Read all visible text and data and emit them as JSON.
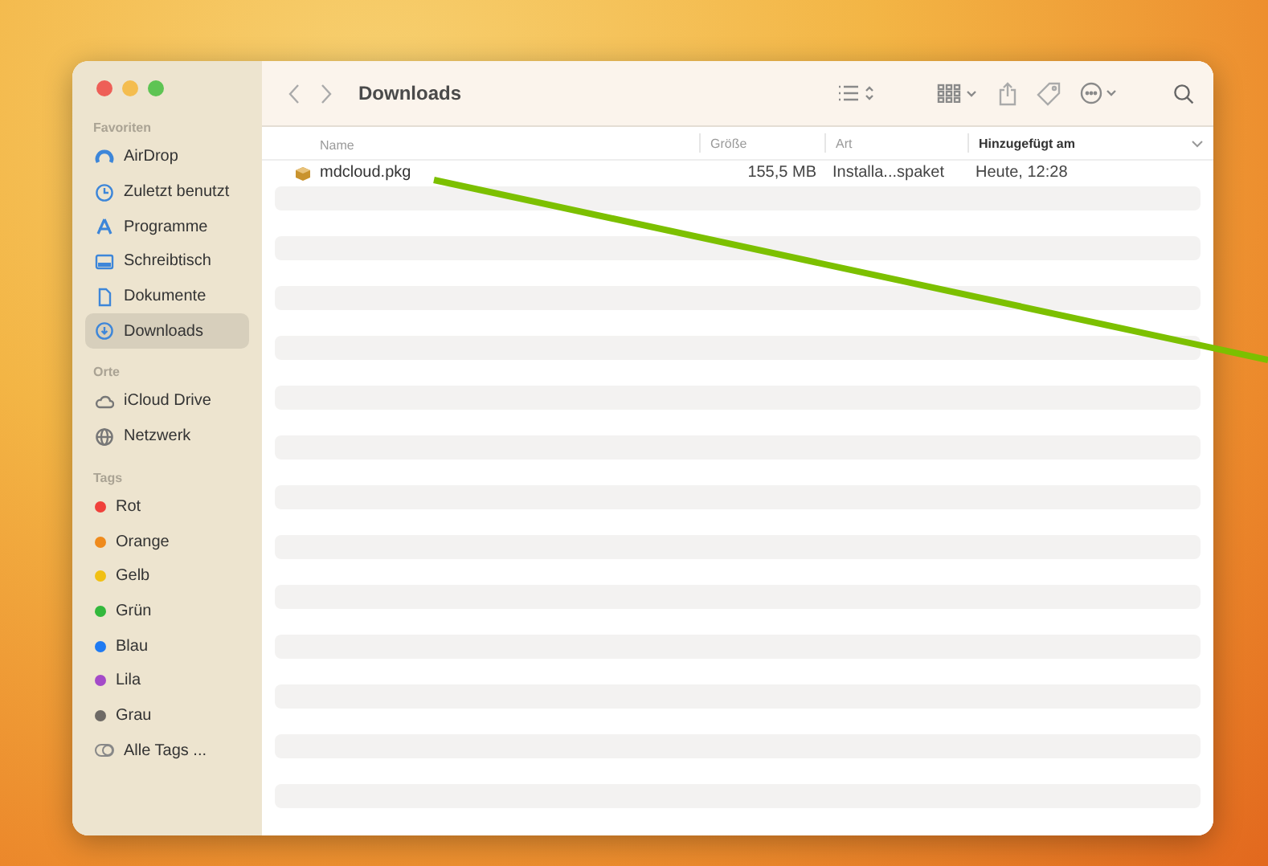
{
  "sidebar": {
    "sections": [
      {
        "heading": "Favoriten",
        "items": [
          {
            "label": "AirDrop",
            "kind": "airdrop",
            "selected": false
          },
          {
            "label": "Zuletzt benutzt",
            "kind": "clock",
            "selected": false
          },
          {
            "label": "Programme",
            "kind": "apps",
            "selected": false
          },
          {
            "label": "Schreibtisch",
            "kind": "desktop",
            "selected": false
          },
          {
            "label": "Dokumente",
            "kind": "document",
            "selected": false
          },
          {
            "label": "Downloads",
            "kind": "download",
            "selected": true
          }
        ]
      },
      {
        "heading": "Orte",
        "items": [
          {
            "label": "iCloud Drive",
            "kind": "cloud",
            "selected": false
          },
          {
            "label": "Netzwerk",
            "kind": "network",
            "selected": false
          }
        ]
      },
      {
        "heading": "Tags",
        "items": [
          {
            "label": "Rot",
            "kind": "tag",
            "color": "#f0413b",
            "selected": false
          },
          {
            "label": "Orange",
            "kind": "tag",
            "color": "#ef8a1c",
            "selected": false
          },
          {
            "label": "Gelb",
            "kind": "tag",
            "color": "#f1c013",
            "selected": false
          },
          {
            "label": "Grün",
            "kind": "tag",
            "color": "#33b83c",
            "selected": false
          },
          {
            "label": "Blau",
            "kind": "tag",
            "color": "#1f7af2",
            "selected": false
          },
          {
            "label": "Lila",
            "kind": "tag",
            "color": "#a44ac8",
            "selected": false
          },
          {
            "label": "Grau",
            "kind": "tag",
            "color": "#6e6a66",
            "selected": false
          },
          {
            "label": "Alle Tags ...",
            "kind": "alltags",
            "selected": false
          }
        ]
      }
    ]
  },
  "toolbar": {
    "title": "Downloads"
  },
  "table": {
    "columns": [
      {
        "label": "Name",
        "sorted": false
      },
      {
        "label": "Größe",
        "sorted": false
      },
      {
        "label": "Art",
        "sorted": false
      },
      {
        "label": "Hinzugefügt am",
        "sorted": true
      }
    ],
    "rows": [
      {
        "name": "mdcloud.pkg",
        "size": "155,5 MB",
        "kind": "Installa...spaket",
        "added": "Heute, 12:28"
      }
    ]
  }
}
